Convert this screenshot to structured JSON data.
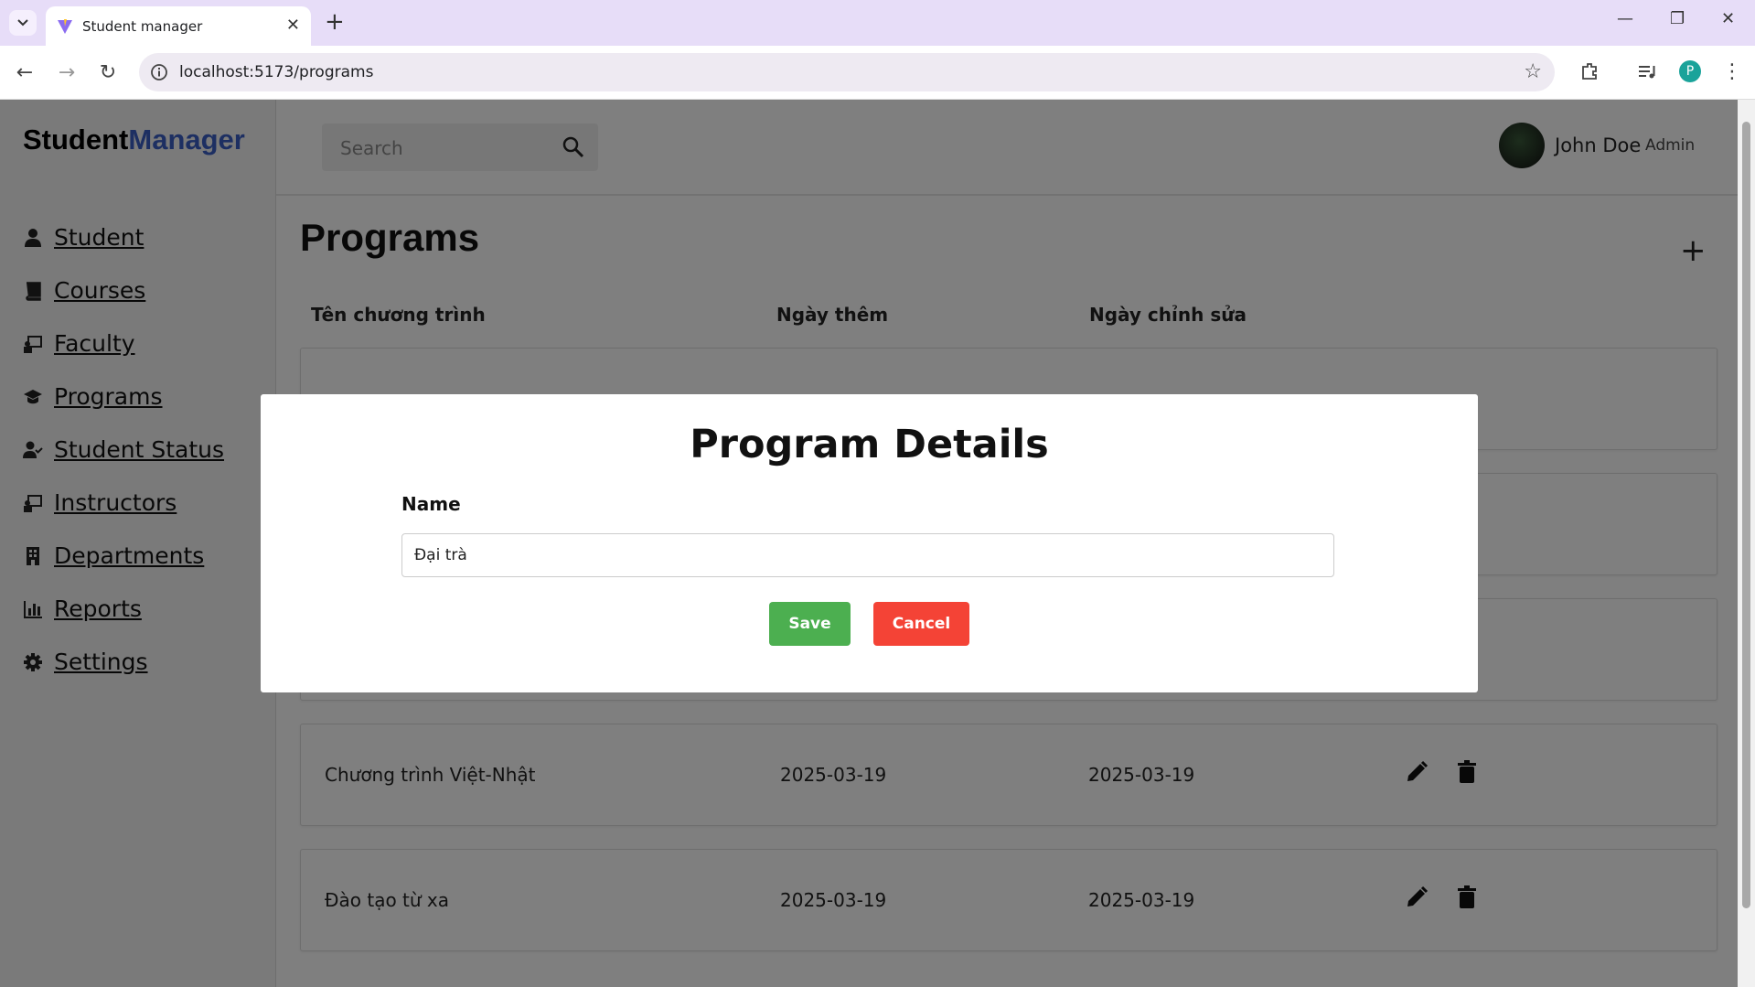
{
  "browser": {
    "tab_title": "Student manager",
    "url": "localhost:5173/programs",
    "profile_initial": "P"
  },
  "app": {
    "brand_part1": "Student",
    "brand_part2": "Manager",
    "search_placeholder": "Search",
    "user_name": "John Doe",
    "user_role": "Admin",
    "nav": [
      {
        "label": "Student",
        "icon": "user-icon"
      },
      {
        "label": "Courses",
        "icon": "book-icon"
      },
      {
        "label": "Faculty",
        "icon": "chalkboard-icon"
      },
      {
        "label": "Programs",
        "icon": "graduation-cap-icon"
      },
      {
        "label": "Student Status",
        "icon": "user-check-icon"
      },
      {
        "label": "Instructors",
        "icon": "chalkboard-teacher-icon"
      },
      {
        "label": "Departments",
        "icon": "building-icon"
      },
      {
        "label": "Reports",
        "icon": "chart-bar-icon"
      },
      {
        "label": "Settings",
        "icon": "gear-icon"
      }
    ]
  },
  "programs": {
    "title": "Programs",
    "columns": [
      "Tên chương trình",
      "Ngày thêm",
      "Ngày chỉnh sửa"
    ],
    "rows": [
      {
        "name": "Chương trình Việt-Nhật",
        "added": "2025-03-19",
        "modified": "2025-03-19"
      },
      {
        "name": "Đào tạo từ xa",
        "added": "2025-03-19",
        "modified": "2025-03-19"
      }
    ]
  },
  "modal": {
    "title": "Program Details",
    "name_label": "Name",
    "name_value": "Đại trà",
    "save_label": "Save",
    "cancel_label": "Cancel"
  },
  "colors": {
    "brand_accent": "#3b5fc4",
    "save": "#4caf50",
    "cancel": "#f44336"
  }
}
